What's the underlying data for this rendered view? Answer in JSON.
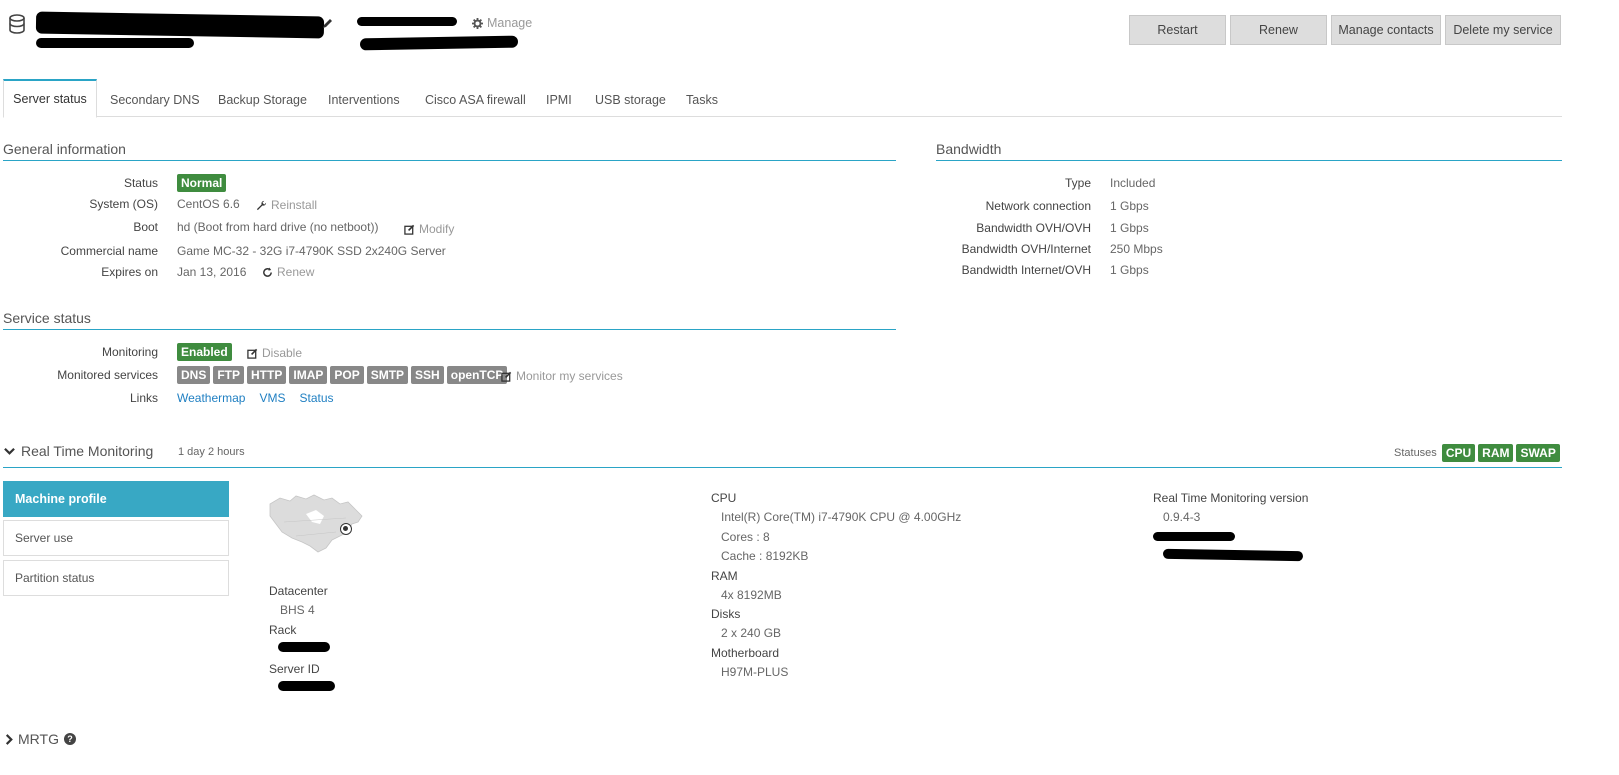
{
  "header": {
    "manage_label": "Manage",
    "buttons": {
      "restart": "Restart",
      "renew": "Renew",
      "manage_contacts": "Manage contacts",
      "delete_service": "Delete my service"
    }
  },
  "tabs": [
    "Server status",
    "Secondary DNS",
    "Backup Storage",
    "Interventions",
    "Cisco ASA firewall",
    "IPMI",
    "USB storage",
    "Tasks"
  ],
  "general": {
    "title": "General information",
    "status_label": "Status",
    "status_value": "Normal",
    "os_label": "System (OS)",
    "os_value": "CentOS 6.6",
    "reinstall": "Reinstall",
    "boot_label": "Boot",
    "boot_value": "hd (Boot from hard drive (no netboot))",
    "modify": "Modify",
    "commercial_label": "Commercial name",
    "commercial_value": "Game MC-32 - 32G i7-4790K SSD 2x240G Server",
    "expires_label": "Expires on",
    "expires_value": "Jan 13, 2016",
    "renew": "Renew"
  },
  "bandwidth": {
    "title": "Bandwidth",
    "rows": [
      {
        "label": "Type",
        "value": "Included"
      },
      {
        "label": "Network connection",
        "value": "1 Gbps"
      },
      {
        "label": "Bandwidth OVH/OVH",
        "value": "1 Gbps"
      },
      {
        "label": "Bandwidth OVH/Internet",
        "value": "250 Mbps"
      },
      {
        "label": "Bandwidth Internet/OVH",
        "value": "1 Gbps"
      }
    ]
  },
  "service": {
    "title": "Service status",
    "monitoring_label": "Monitoring",
    "monitoring_value": "Enabled",
    "disable": "Disable",
    "monitored_label": "Monitored services",
    "services": [
      "DNS",
      "FTP",
      "HTTP",
      "IMAP",
      "POP",
      "SMTP",
      "SSH",
      "openTCP"
    ],
    "monitor_link": "Monitor my services",
    "links_label": "Links",
    "links": [
      "Weathermap",
      "VMS",
      "Status"
    ]
  },
  "rtm": {
    "title": "Real Time Monitoring",
    "uptime": "1 day 2 hours",
    "statuses_label": "Statuses",
    "statuses": [
      "CPU",
      "RAM",
      "SWAP"
    ],
    "side": [
      "Machine profile",
      "Server use",
      "Partition status"
    ],
    "datacenter_label": "Datacenter",
    "datacenter_value": "BHS 4",
    "rack_label": "Rack",
    "server_id_label": "Server ID",
    "cpu_label": "CPU",
    "cpu_model": "Intel(R) Core(TM) i7-4790K CPU @ 4.00GHz",
    "cores": "Cores : 8",
    "cache": "Cache : 8192KB",
    "ram_label": "RAM",
    "ram_value": "4x 8192MB",
    "disks_label": "Disks",
    "disks_value": "2 x 240 GB",
    "mb_label": "Motherboard",
    "mb_value": "H97M-PLUS",
    "version_label": "Real Time Monitoring version",
    "version_value": "0.9.4-3"
  },
  "mrtg": {
    "title": "MRTG"
  },
  "colors": {
    "accent": "#2aa4c6",
    "green": "#3f8c3f",
    "grey_badge": "#888888",
    "link": "#1f7fc2"
  }
}
